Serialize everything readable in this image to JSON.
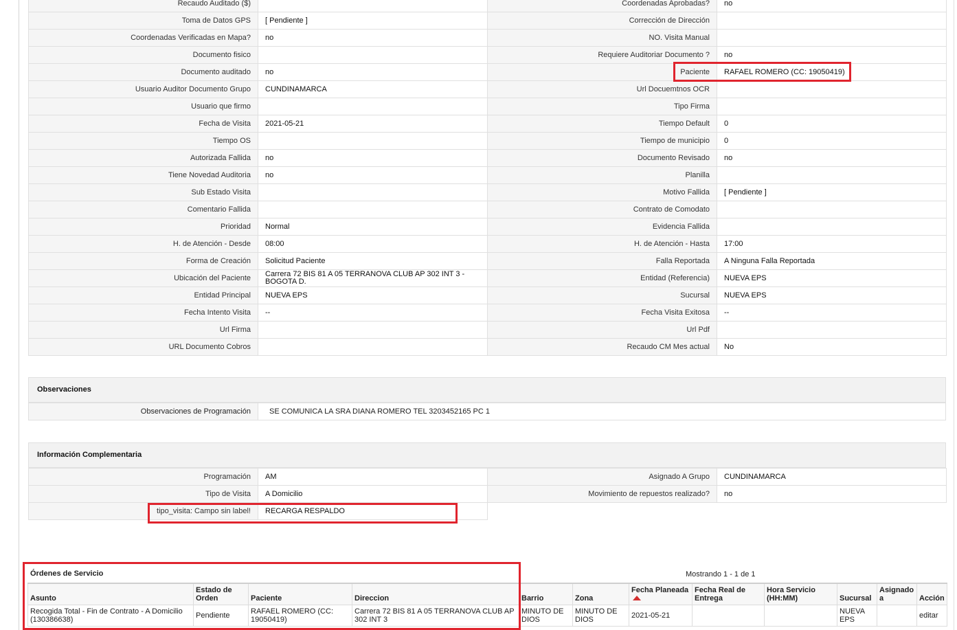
{
  "details": {
    "rows": [
      {
        "l1": "Recaudo Auditado ($)",
        "v1": "",
        "l2": "Coordenadas Aprobadas?",
        "v2": "no"
      },
      {
        "l1": "Toma de Datos GPS",
        "v1": "[ Pendiente ]",
        "l2": "Corrección de Dirección",
        "v2": ""
      },
      {
        "l1": "Coordenadas Verificadas en Mapa?",
        "v1": "no",
        "l2": "NO. Visita Manual",
        "v2": ""
      },
      {
        "l1": "Documento fisico",
        "v1": "",
        "l2": "Requiere Auditoriar Documento ?",
        "v2": "no"
      },
      {
        "l1": "Documento auditado",
        "v1": "no",
        "l2": "Paciente",
        "v2": "RAFAEL ROMERO (CC: 19050419)"
      },
      {
        "l1": "Usuario Auditor Documento Grupo",
        "v1": "CUNDINAMARCA",
        "l2": "Url Docuemtnos OCR",
        "v2": ""
      },
      {
        "l1": "Usuario que firmo",
        "v1": "",
        "l2": "Tipo Firma",
        "v2": ""
      },
      {
        "l1": "Fecha de Visita",
        "v1": "2021-05-21",
        "l2": "Tiempo Default",
        "v2": "0"
      },
      {
        "l1": "Tiempo OS",
        "v1": "",
        "l2": "Tiempo de municipio",
        "v2": "0"
      },
      {
        "l1": "Autorizada Fallida",
        "v1": "no",
        "l2": "Documento Revisado",
        "v2": "no"
      },
      {
        "l1": "Tiene Novedad Auditoria",
        "v1": "no",
        "l2": "Planilla",
        "v2": ""
      },
      {
        "l1": "Sub Estado Visita",
        "v1": "",
        "l2": "Motivo Fallida",
        "v2": "[ Pendiente ]"
      },
      {
        "l1": "Comentario Fallida",
        "v1": "",
        "l2": "Contrato de Comodato",
        "v2": ""
      },
      {
        "l1": "Prioridad",
        "v1": "Normal",
        "l2": "Evidencia Fallida",
        "v2": ""
      },
      {
        "l1": "H. de Atención - Desde",
        "v1": "08:00",
        "l2": "H. de Atención - Hasta",
        "v2": "17:00"
      },
      {
        "l1": "Forma de Creación",
        "v1": "Solicitud Paciente",
        "l2": "Falla Reportada",
        "v2": "A Ninguna Falla Reportada"
      },
      {
        "l1": "Ubicación del Paciente",
        "v1": "Carrera 72 BIS 81 A 05 TERRANOVA CLUB AP 302 INT 3 - BOGOTA D.",
        "l2": "Entidad (Referencia)",
        "v2": "NUEVA EPS"
      },
      {
        "l1": "Entidad Principal",
        "v1": "NUEVA EPS",
        "l2": "Sucursal",
        "v2": "NUEVA EPS"
      },
      {
        "l1": "Fecha Intento Visita",
        "v1": "--",
        "l2": "Fecha Visita Exitosa",
        "v2": "--"
      },
      {
        "l1": "Url Firma",
        "v1": "",
        "l2": "Url Pdf",
        "v2": ""
      },
      {
        "l1": "URL Documento Cobros",
        "v1": "",
        "l2": "Recaudo CM Mes actual",
        "v2": "No"
      }
    ]
  },
  "observaciones": {
    "title": "Observaciones",
    "label": "Observaciones de Programación",
    "value": "SE COMUNICA LA SRA DIANA ROMERO TEL 3203452165 PC 1"
  },
  "complementaria": {
    "title": "Información Complementaria",
    "rows": [
      {
        "l1": "Programación",
        "v1": "AM",
        "l2": "Asignado A Grupo",
        "v2": "CUNDINAMARCA"
      },
      {
        "l1": "Tipo de Visita",
        "v1": "A Domicilio",
        "l2": "Movimiento de repuestos realizado?",
        "v2": "no"
      },
      {
        "l1": "tipo_visita: Campo sin label!",
        "v1": "RECARGA RESPALDO"
      }
    ]
  },
  "orders": {
    "title": "Órdenes de Servicio",
    "count_text": "Mostrando 1 - 1 de 1",
    "columns": [
      "Asunto",
      "Estado de Orden",
      "Paciente",
      "Direccion",
      "Barrio",
      "Zona",
      "Fecha Planeada",
      "Fecha Real de Entrega",
      "Hora Servicio (HH:MM)",
      "Sucursal",
      "Asignado a",
      "Acción"
    ],
    "rows": [
      {
        "asunto": "Recogida Total - Fin de Contrato - A Domicilio (130386638)",
        "estado": "Pendiente",
        "paciente": "RAFAEL ROMERO (CC: 19050419)",
        "direccion": "Carrera 72 BIS 81 A 05 TERRANOVA CLUB AP 302 INT 3",
        "barrio": "MINUTO DE DIOS",
        "zona": "MINUTO DE DIOS",
        "fecha_planeada": "2021-05-21",
        "fecha_real": "",
        "hora": "",
        "sucursal": "NUEVA EPS",
        "asignado": "",
        "accion": "editar"
      }
    ]
  },
  "colors": {
    "highlight": "#e0242e",
    "sort": "#d32f2f"
  },
  "icons": {
    "sort": "sort-ascending-icon"
  }
}
